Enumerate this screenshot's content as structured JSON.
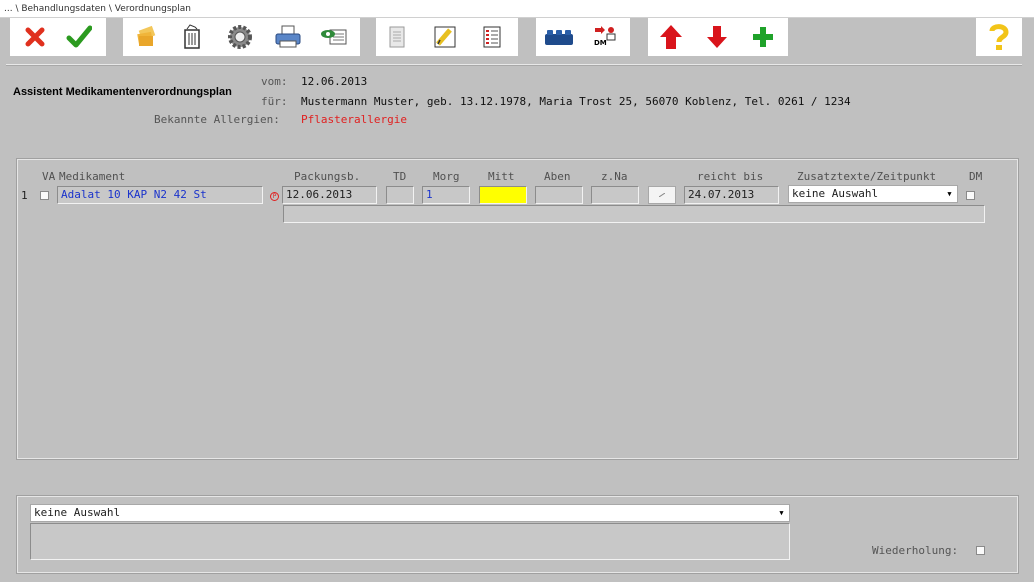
{
  "window": {
    "title": "... \\ Behandlungsdaten \\ Verordnungsplan"
  },
  "toolbar": {
    "buttons": [
      {
        "icon": "cancel-x-icon"
      },
      {
        "icon": "confirm-check-icon"
      },
      {
        "icon": "stack-icon"
      },
      {
        "icon": "trash-icon"
      },
      {
        "icon": "gear-icon"
      },
      {
        "icon": "printer-icon"
      },
      {
        "icon": "card-eye-icon"
      },
      {
        "icon": "document-icon"
      },
      {
        "icon": "edit-icon"
      },
      {
        "icon": "checklist-icon"
      },
      {
        "icon": "blocks-icon"
      },
      {
        "icon": "dm-icon",
        "text": "DM"
      },
      {
        "icon": "arrow-up-icon"
      },
      {
        "icon": "arrow-down-icon"
      },
      {
        "icon": "plus-icon"
      },
      {
        "icon": "help-icon"
      }
    ]
  },
  "header": {
    "title": "Assistent Medikamentenverordnungsplan",
    "vom_label": "vom:",
    "vom_value": "12.06.2013",
    "fuer_label": "für:",
    "fuer_value": "Mustermann Muster, geb. 13.12.1978, Maria Trost 25, 56070 Koblenz, Tel. 0261 / 1234",
    "allergien_label": "Bekannte Allergien:",
    "allergien_value": "Pflasterallergie"
  },
  "table": {
    "columns": {
      "va": "VA",
      "medikament": "Medikament",
      "packungsb": "Packungsb.",
      "td": "TD",
      "morg": "Morg",
      "mitt": "Mitt",
      "aben": "Aben",
      "zna": "z.Na",
      "reicht_bis": "reicht bis",
      "zusatz": "Zusatztexte/Zeitpunkt",
      "dm": "DM"
    },
    "rows": [
      {
        "num": "1",
        "medikament": "Adalat 10 KAP N2 42 St",
        "badge": "P",
        "packungsb": "12.06.2013",
        "td": "",
        "morg": "1",
        "mitt": "",
        "aben": "",
        "zna": "",
        "reicht_bis": "24.07.2013",
        "zusatz": "keine Auswahl"
      }
    ]
  },
  "bottom": {
    "combo_value": "keine Auswahl",
    "wiederholung_label": "Wiederholung:"
  },
  "colors": {
    "mitt_highlight": "#ffff00",
    "allergy_red": "#e02020",
    "med_blue": "#1a33cc"
  }
}
